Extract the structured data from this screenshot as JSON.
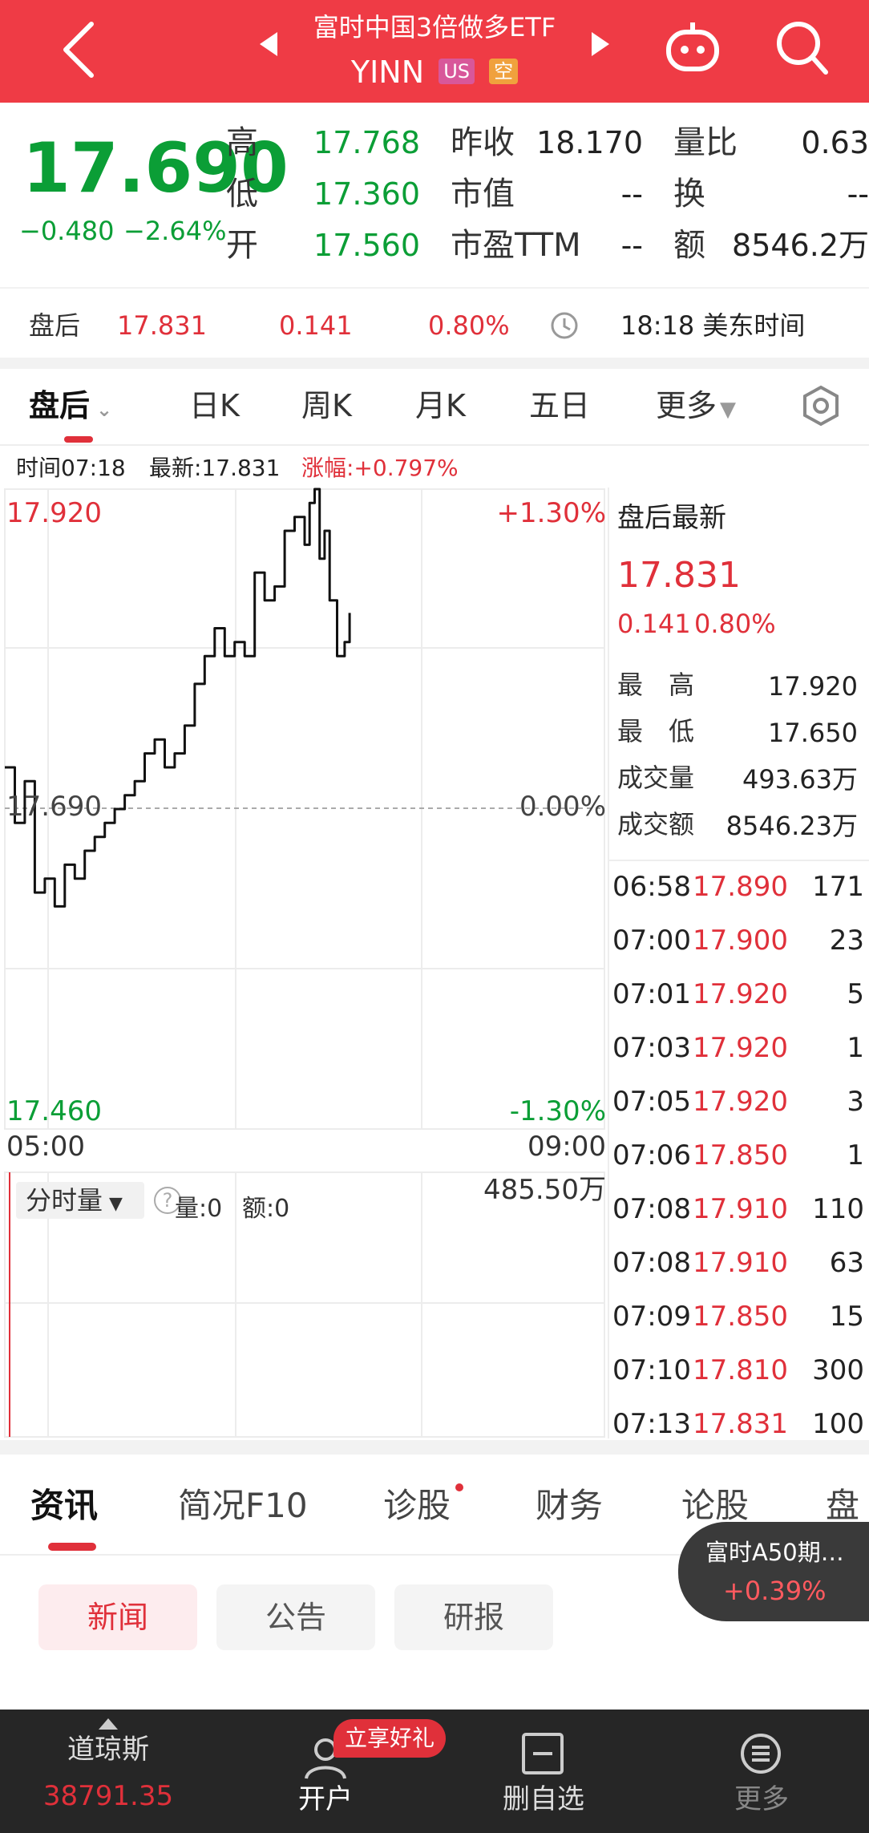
{
  "header": {
    "title": "富时中国3倍做多ETF",
    "ticker": "YINN",
    "market_badge": "US",
    "short_badge": "空",
    "icons": [
      "back-arrow-icon",
      "prev-triangle-icon",
      "next-triangle-icon",
      "robot-icon",
      "search-icon"
    ]
  },
  "quote": {
    "price": "17.690",
    "change": "−0.480",
    "change_pct": "−2.64%",
    "high_label": "高",
    "high": "17.768",
    "low_label": "低",
    "low": "17.360",
    "open_label": "开",
    "open": "17.560",
    "prev_close_label": "昨收",
    "prev_close": "18.170",
    "market_cap_label": "市值",
    "market_cap": "--",
    "pe_label": "市盈TTM",
    "pe": "--",
    "vol_ratio_label": "量比",
    "vol_ratio": "0.63",
    "turnover_label": "换",
    "turnover": "--",
    "amount_label": "额",
    "amount": "8546.2万"
  },
  "after_hours": {
    "label": "盘后",
    "price": "17.831",
    "change": "0.141",
    "pct": "0.80%",
    "time": "18:18 美东时间"
  },
  "chart_tabs": [
    "盘后",
    "日K",
    "周K",
    "月K",
    "五日",
    "更多"
  ],
  "crosshair": {
    "time": "时间07:18",
    "latest": "最新:17.831",
    "change": "涨幅:+0.797%"
  },
  "chart_labels": {
    "y_top": "17.920",
    "y_mid": "17.690",
    "y_bot": "17.460",
    "pct_top": "+1.30%",
    "pct_mid": "0.00%",
    "pct_bot": "-1.30%",
    "x_start": "05:00",
    "x_end": "09:00",
    "vol_max": "485.50万",
    "vol_tab": "分时量",
    "vol_info": "量:0",
    "amt_info": "额:0"
  },
  "chart_data": {
    "type": "line",
    "x_range": [
      "05:00",
      "09:00"
    ],
    "ylim": [
      17.46,
      17.92
    ],
    "baseline": 17.69,
    "x": [
      "05:00",
      "05:04",
      "05:08",
      "05:12",
      "05:16",
      "05:20",
      "05:24",
      "05:28",
      "05:32",
      "05:36",
      "05:40",
      "05:44",
      "05:48",
      "05:52",
      "05:56",
      "06:00",
      "06:04",
      "06:08",
      "06:12",
      "06:16",
      "06:20",
      "06:24",
      "06:28",
      "06:32",
      "06:36",
      "06:40",
      "06:44",
      "06:48",
      "06:52",
      "06:56",
      "07:00",
      "07:02",
      "07:04",
      "07:06",
      "07:08",
      "07:10",
      "07:13",
      "07:16",
      "07:18"
    ],
    "y": [
      17.72,
      17.68,
      17.71,
      17.63,
      17.64,
      17.62,
      17.65,
      17.64,
      17.66,
      17.67,
      17.68,
      17.69,
      17.7,
      17.71,
      17.73,
      17.74,
      17.72,
      17.73,
      17.75,
      17.78,
      17.8,
      17.82,
      17.8,
      17.81,
      17.8,
      17.86,
      17.84,
      17.85,
      17.89,
      17.9,
      17.88,
      17.91,
      17.92,
      17.87,
      17.89,
      17.84,
      17.8,
      17.81,
      17.831
    ]
  },
  "right_panel": {
    "title": "盘后最新",
    "price": "17.831",
    "change": "0.141",
    "pct": "0.80%",
    "high_label": "最　高",
    "high": "17.920",
    "low_label": "最　低",
    "low": "17.650",
    "vol_label": "成交量",
    "vol": "493.63万",
    "amt_label": "成交额",
    "amt": "8546.23万"
  },
  "trades": [
    {
      "time": "06:58",
      "price": "17.890",
      "vol": "171"
    },
    {
      "time": "07:00",
      "price": "17.900",
      "vol": "23"
    },
    {
      "time": "07:01",
      "price": "17.920",
      "vol": "5"
    },
    {
      "time": "07:03",
      "price": "17.920",
      "vol": "1"
    },
    {
      "time": "07:05",
      "price": "17.920",
      "vol": "3"
    },
    {
      "time": "07:06",
      "price": "17.850",
      "vol": "1"
    },
    {
      "time": "07:08",
      "price": "17.910",
      "vol": "110"
    },
    {
      "time": "07:08",
      "price": "17.910",
      "vol": "63"
    },
    {
      "time": "07:09",
      "price": "17.850",
      "vol": "15"
    },
    {
      "time": "07:10",
      "price": "17.810",
      "vol": "300"
    },
    {
      "time": "07:13",
      "price": "17.831",
      "vol": "100"
    }
  ],
  "info_tabs": [
    "资讯",
    "简况F10",
    "诊股",
    "财务",
    "论股",
    "盘"
  ],
  "float_card": {
    "name": "富时A50期…",
    "pct": "+0.39%"
  },
  "pills": [
    "新闻",
    "公告",
    "研报"
  ],
  "bottom_nav": {
    "index_name": "道琼斯",
    "index_value": "38791.35",
    "open_account": "开户",
    "gift": "立享好礼",
    "remove_watch": "删自选",
    "more": "更多"
  },
  "colors": {
    "red": "#e0303a",
    "green": "#0b9e36",
    "header": "#ef3b45"
  }
}
